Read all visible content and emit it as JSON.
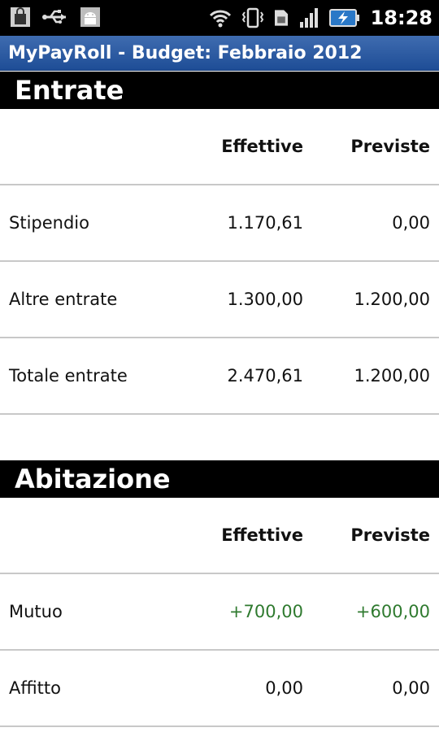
{
  "status_bar": {
    "time": "18:28",
    "icons": [
      "shopping-bag-icon",
      "usb-icon",
      "android-icon",
      "wifi-icon",
      "vibrate-icon",
      "sim-icon",
      "signal-icon",
      "battery-charging-icon"
    ]
  },
  "app": {
    "title": "MyPayRoll - Budget: Febbraio 2012"
  },
  "colors": {
    "title_bar": "#2d5ca3",
    "section_header": "#000000",
    "positive_value": "#2f7a2f"
  },
  "sections": [
    {
      "title": "Entrate",
      "columns": [
        "Effettive",
        "Previste"
      ],
      "rows": [
        {
          "label": "Stipendio",
          "effettive": "1.170,61",
          "previste": "0,00"
        },
        {
          "label": "Altre entrate",
          "effettive": "1.300,00",
          "previste": "1.200,00"
        },
        {
          "label": "Totale entrate",
          "effettive": "2.470,61",
          "previste": "1.200,00"
        }
      ]
    },
    {
      "title": "Abitazione",
      "columns": [
        "Effettive",
        "Previste"
      ],
      "rows": [
        {
          "label": "Mutuo",
          "effettive": "+700,00",
          "previste": "+600,00"
        },
        {
          "label": "Affitto",
          "effettive": "0,00",
          "previste": "0,00"
        }
      ]
    }
  ]
}
